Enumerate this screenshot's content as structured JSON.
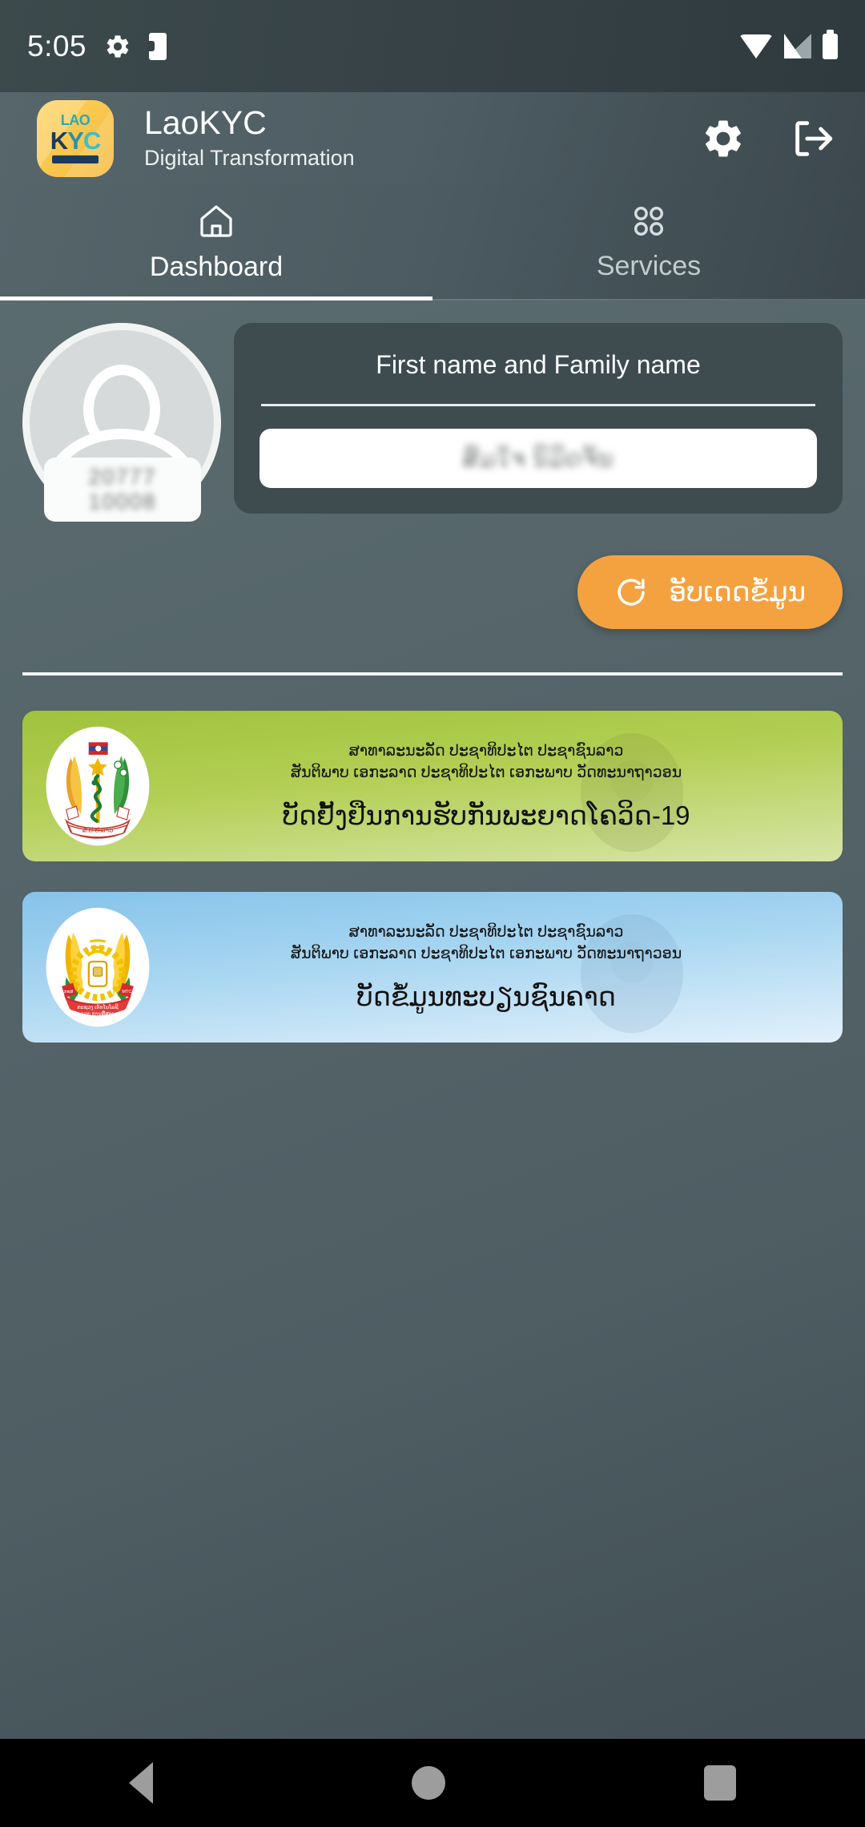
{
  "status_bar": {
    "time": "5:05",
    "icons_left": [
      "gear-icon",
      "note-icon"
    ],
    "icons_right": [
      "wifi-icon",
      "signal-icon",
      "battery-icon"
    ]
  },
  "header": {
    "logo": {
      "top_text": "LAO",
      "bottom_text": "KYC"
    },
    "title": "LaoKYC",
    "subtitle": "Digital Transformation",
    "actions": [
      {
        "name": "settings-button",
        "icon": "gear-icon"
      },
      {
        "name": "logout-button",
        "icon": "logout-icon"
      }
    ]
  },
  "tabs": [
    {
      "label": "Dashboard",
      "icon": "home-icon",
      "active": true
    },
    {
      "label": "Services",
      "icon": "grid-icon",
      "active": false
    }
  ],
  "profile": {
    "id_number": "20777 10008",
    "name_label": "First name and Family name",
    "name_value": "ສົມໃຈ ນິມິດຈັນ",
    "avatar_icon": "person-placeholder-icon"
  },
  "update_button": {
    "label": "ອັບເດດຂໍ້ມູນ",
    "icon": "refresh-icon",
    "color": "#f4a23f"
  },
  "cards": [
    {
      "name": "covid-vaccination-card",
      "theme": "green",
      "accent": "#a0c23c",
      "line1": "ສາທາລະນະລັດ ປະຊາທິປະໄຕ ປະຊາຊົນລາວ",
      "line2": "ສັນຕິພາບ ເອກະລາດ ປະຊາທິປະໄຕ ເອກະພາບ ວັດທະນາຖາວອນ",
      "title": "ບັດຢັ້ງຢືນການຮັບກັນພະຍາດໂຄວິດ-19",
      "seal": "lao-ministry-of-health-emblem"
    },
    {
      "name": "national-id-registry-card",
      "theme": "blue",
      "accent": "#86c3ea",
      "line1": "ສາທາລະນະລັດ ປະຊາທິປະໄຕ ປະຊາຊົນລາວ",
      "line2": "ສັນຕິພາບ ເອກະລາດ ປະຊາທິປະໄຕ ເອກະພາບ ວັດທະນາຖາວອນ",
      "title": "ບັດຂໍ້ມູນທະບຽນຊົນຄາດ",
      "seal": "lao-mtc-emblem"
    }
  ],
  "navigation_bar": {
    "back": "back-icon",
    "home": "home-icon",
    "recents": "recents-icon"
  }
}
